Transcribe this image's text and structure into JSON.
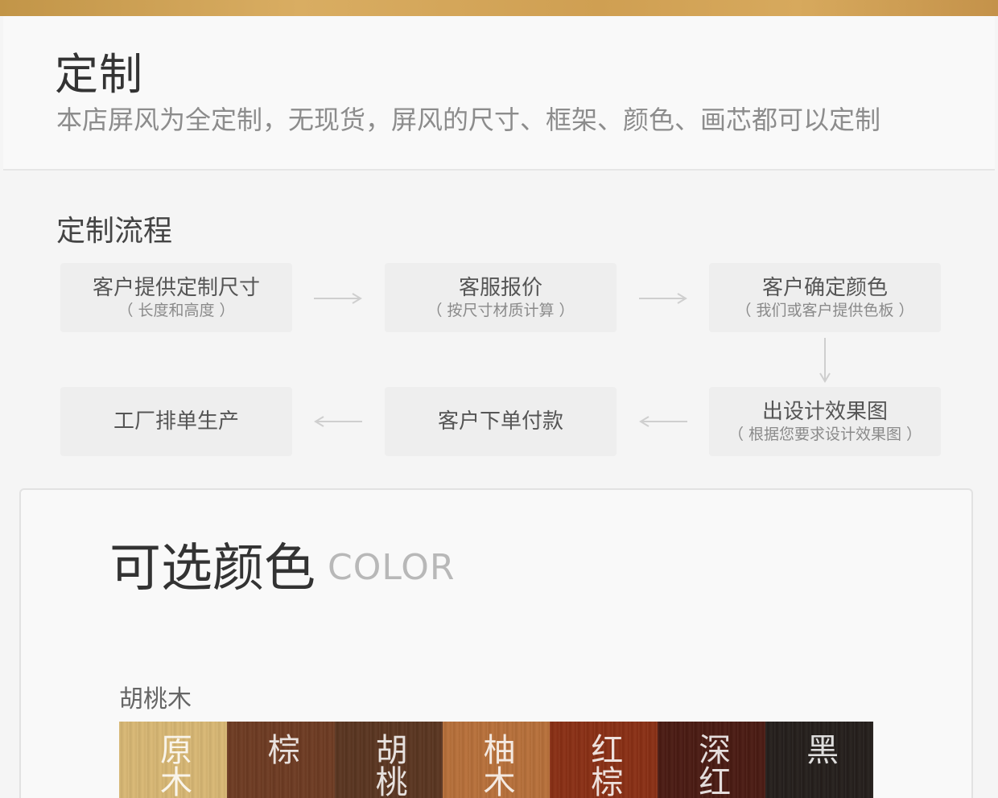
{
  "header": {
    "title": "定制",
    "subtitle": "本店屏风为全定制，无现货，屏风的尺寸、框架、颜色、画芯都可以定制"
  },
  "process": {
    "title": "定制流程",
    "steps": [
      {
        "title": "客户提供定制尺寸",
        "note": "（ 长度和高度 ）"
      },
      {
        "title": "客服报价",
        "note": "（ 按尺寸材质计算 ）"
      },
      {
        "title": "客户确定颜色",
        "note": "（ 我们或客户提供色板 ）"
      },
      {
        "title": "出设计效果图",
        "note": "（ 根据您要求设计效果图 ）"
      },
      {
        "title": "客户下单付款",
        "note": ""
      },
      {
        "title": "工厂排单生产",
        "note": ""
      }
    ]
  },
  "colors": {
    "title": "可选颜色",
    "title_en": "COLOR",
    "wood_label": "胡桃木",
    "swatches": [
      {
        "label": "原木",
        "color": "#d9b874"
      },
      {
        "label": "棕",
        "color": "#6e3b22"
      },
      {
        "label": "胡桃",
        "color": "#5a3520"
      },
      {
        "label": "柚木",
        "color": "#b8703a"
      },
      {
        "label": "红棕",
        "color": "#8a2f14"
      },
      {
        "label": "深红",
        "color": "#4a1a12"
      },
      {
        "label": "黑",
        "color": "#241e1b"
      }
    ]
  },
  "theme": {
    "accent": "#d2a35a",
    "background": "#f5f5f5",
    "step_bg": "#eeeeee"
  }
}
